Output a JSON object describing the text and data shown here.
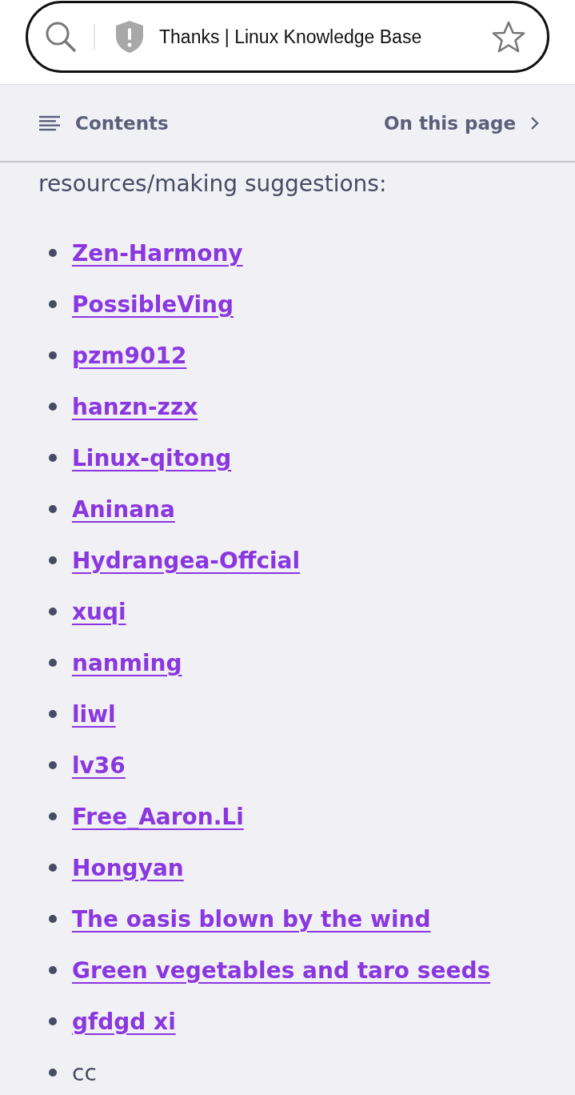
{
  "address_bar": {
    "title": "Thanks | Linux Knowledge Base"
  },
  "toolbar": {
    "contents": "Contents",
    "on_this_page": "On this page"
  },
  "intro": "resources/making suggestions:",
  "items": [
    {
      "kind": "link",
      "text": "Zen-Harmony"
    },
    {
      "kind": "link",
      "text": "PossibleVing"
    },
    {
      "kind": "link",
      "text": "pzm9012"
    },
    {
      "kind": "link",
      "text": "hanzn-zzx"
    },
    {
      "kind": "link",
      "text": "Linux-qitong"
    },
    {
      "kind": "link",
      "text": "Aninana"
    },
    {
      "kind": "link",
      "text": "Hydrangea-Offcial"
    },
    {
      "kind": "link",
      "text": "xuqi"
    },
    {
      "kind": "link",
      "text": "nanming"
    },
    {
      "kind": "link",
      "text": "liwl"
    },
    {
      "kind": "link",
      "text": "lv36"
    },
    {
      "kind": "link",
      "text": "Free_Aaron.Li"
    },
    {
      "kind": "link",
      "text": "Hongyan"
    },
    {
      "kind": "link",
      "text": "The oasis blown by the wind"
    },
    {
      "kind": "link",
      "text": "Green vegetables and taro seeds"
    },
    {
      "kind": "link",
      "text": "gfdgd xi"
    },
    {
      "kind": "text",
      "text": "cc"
    }
  ]
}
